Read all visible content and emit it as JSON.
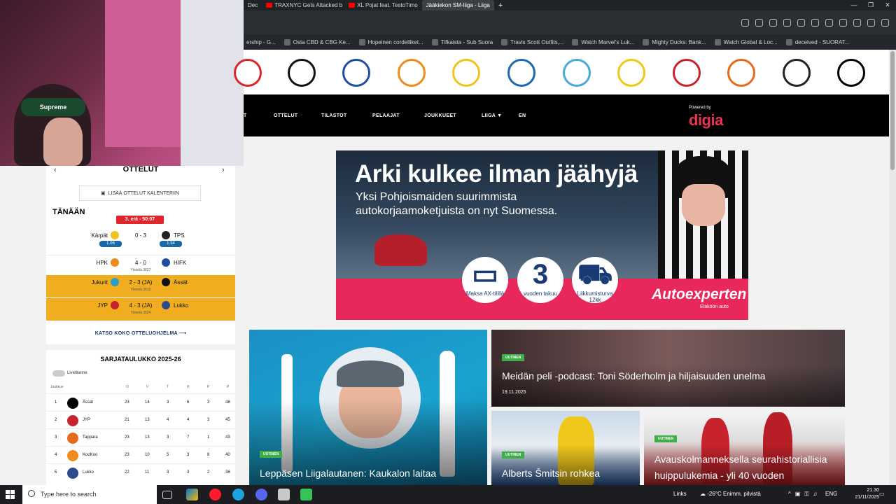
{
  "browser": {
    "tabs": [
      {
        "label": "Dec"
      },
      {
        "label": "TRAXNYC Gets Attacked b"
      },
      {
        "label": "XL Pojat feat. TestoTimo"
      },
      {
        "label": "Jääkiekon SM-liiga - Liiga",
        "active": true
      }
    ],
    "new_tab": "+",
    "window_controls": [
      "—",
      "❐",
      "✕"
    ],
    "bookmarks": [
      "ership - G...",
      "Osta CBD & CBG Ke...",
      "Hopeinen cordelliket...",
      "Tifkaista - Sub Suora",
      "Travis Scott Outfits,...",
      "Watch Marvel's Luk...",
      "Mighty Ducks: Bank...",
      "Watch Global & Loc...",
      "deceived - SUORAT..."
    ]
  },
  "team_logos": [
    {
      "name": "red-team-logo",
      "color": "#d7262d"
    },
    {
      "name": "kalpa-logo",
      "color": "#111111"
    },
    {
      "name": "hifk-logo",
      "color": "#1c4ea1"
    },
    {
      "name": "kookoo-logo",
      "color": "#f08a1b"
    },
    {
      "name": "karpat-logo",
      "color": "#f1c21b"
    },
    {
      "name": "hpk-pelicans-logo",
      "color": "#2167b0"
    },
    {
      "name": "pelicans-logo",
      "color": "#4aa8d8"
    },
    {
      "name": "ilves-logo",
      "color": "#f0c81b"
    },
    {
      "name": "assat-eagle-logo",
      "color": "#c8232c"
    },
    {
      "name": "tappara-logo",
      "color": "#e66a1d"
    },
    {
      "name": "tps-logo",
      "color": "#222222"
    },
    {
      "name": "assat-logo",
      "color": "#000000"
    }
  ],
  "nav": {
    "items": [
      "OTTELUT",
      "TILASTOT",
      "PELAAJAT",
      "JOUKKUEET",
      "LIIGA ▼",
      "EN"
    ],
    "powered_by": "Powered by",
    "sponsor": "digia"
  },
  "webcam": {
    "headband_text": "Supreme"
  },
  "games": {
    "title": "OTTELUT",
    "prev": "‹",
    "next": "›",
    "calendar_btn": "LISÄÄ OTTELUT KALENTERIIN",
    "today": "TÄNÄÄN",
    "live_badge": "3. erä - 50:07",
    "rows": [
      {
        "home": "Kärpät",
        "score": "0 - 3",
        "away": "TPS",
        "sub": "",
        "highlight": false,
        "home_color": "#f1c21b",
        "away_color": "#222"
      },
      {
        "home": "HPK",
        "score": "4 - 0",
        "away": "HIFK",
        "sub": "Yleisöä 3627",
        "highlight": false,
        "home_color": "#f08a1b",
        "away_color": "#1c4ea1"
      },
      {
        "home": "Jukurit",
        "score": "2 - 3 (JA)",
        "away": "Ässät",
        "sub": "Yleisöä 2610",
        "highlight": true,
        "home_color": "#2a9ec7",
        "away_color": "#111"
      },
      {
        "home": "JYP",
        "score": "4 - 3 (JA)",
        "away": "Lukko",
        "sub": "Yleisöä 3524",
        "highlight": true,
        "home_color": "#c8232c",
        "away_color": "#2d4b8a"
      }
    ],
    "pills": [
      "1.06",
      "1.34"
    ],
    "see_all": "KATSO KOKO OTTELUOHJELMA ⟶"
  },
  "standings": {
    "title": "SARJATAULUKKO 2025-26",
    "toggle_label": "Livetilanne",
    "headers": [
      "Joukkue",
      "O",
      "V",
      "T",
      "H",
      "P",
      "P"
    ],
    "rows": [
      {
        "pos": "1",
        "team": "Ässät",
        "o": "23",
        "v": "14",
        "t": "3",
        "h": "6",
        "p1": "3",
        "pts": "48",
        "color": "#000000"
      },
      {
        "pos": "2",
        "team": "JYP",
        "o": "21",
        "v": "13",
        "t": "4",
        "h": "4",
        "p1": "3",
        "pts": "45",
        "color": "#c8232c"
      },
      {
        "pos": "3",
        "team": "Tappara",
        "o": "23",
        "v": "13",
        "t": "3",
        "h": "7",
        "p1": "1",
        "pts": "43",
        "color": "#e66a1d"
      },
      {
        "pos": "4",
        "team": "KooKoo",
        "o": "23",
        "v": "10",
        "t": "5",
        "h": "3",
        "p1": "8",
        "pts": "40",
        "color": "#f08a1b"
      },
      {
        "pos": "5",
        "team": "Lukko",
        "o": "22",
        "v": "11",
        "t": "3",
        "h": "3",
        "p1": "2",
        "pts": "38",
        "color": "#2d4b8a"
      }
    ]
  },
  "ad": {
    "title": "Arki kulkee ilman jäähyjä",
    "subtitle": "Yksi Pohjoismaiden suurimmista autokorjaamoketjuista on nyt Suomessa.",
    "badges": [
      {
        "big": "",
        "text": "Maksa AX-tilillä"
      },
      {
        "big": "3",
        "text": "vuoden takuu"
      },
      {
        "big": "",
        "text": "Liikkumisturva 12kk"
      }
    ],
    "brand": "Autoexperten",
    "brand_sub": "Elaköön auto",
    "helmet_text": "Autoexperten"
  },
  "news": [
    {
      "tag": "UUTINEN",
      "title": "Leppäsen Liigalautanen: Kaukalon laitaa",
      "date": ""
    },
    {
      "tag": "UUTINEN",
      "title": "Meidän peli -podcast: Toni Söderholm ja hiljaisuuden unelma",
      "date": "19.11.2025"
    },
    {
      "tag": "UUTINEN",
      "title": "Alberts Šmitsin rohkea",
      "date": ""
    },
    {
      "tag": "UUTINEN",
      "title": "Avauskolmanneksella seurahistoriallisia huippulukemia - yli 40 vuoden",
      "date": ""
    }
  ],
  "taskbar": {
    "search_placeholder": "Type here to search",
    "links": "Links",
    "weather": "-26°C  Enimm. pilvistä",
    "lang": "ENG",
    "time": "21.30",
    "date": "21/11/2025"
  }
}
